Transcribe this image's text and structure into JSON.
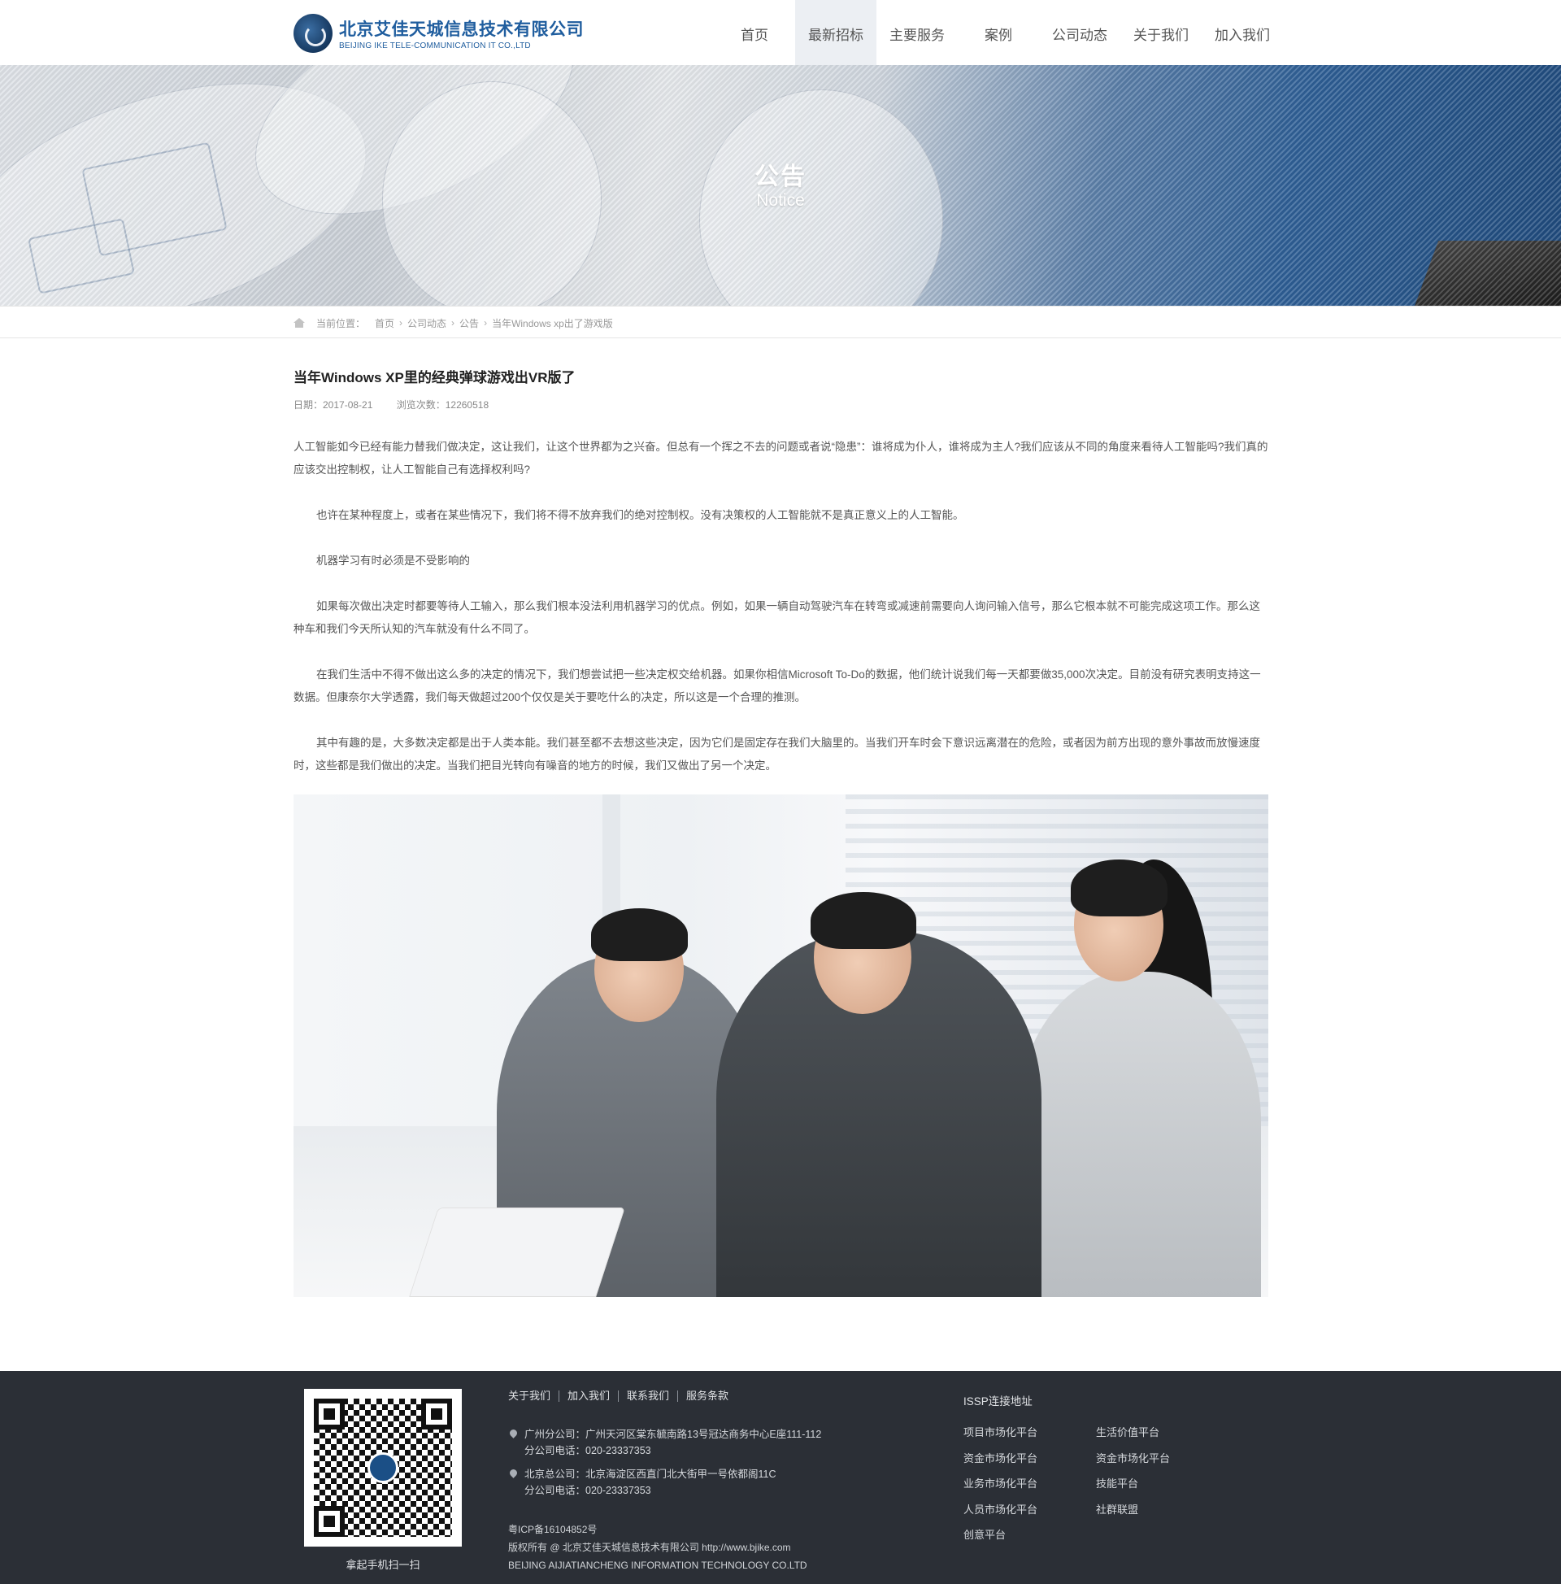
{
  "header": {
    "logo_cn": "北京艾佳天城信息技术有限公司",
    "logo_en": "BEIJING IKE TELE-COMMUNICATION IT CO.,LTD",
    "nav": [
      "首页",
      "最新招标",
      "主要服务",
      "案例",
      "公司动态",
      "关于我们",
      "加入我们"
    ],
    "active_nav": "最新招标"
  },
  "banner": {
    "title": "公告",
    "subtitle": "Notice"
  },
  "breadcrumb": {
    "label": "当前位置：",
    "items": [
      "首页",
      "公司动态",
      "公告",
      "当年Windows xp出了游戏版"
    ]
  },
  "article": {
    "title": "当年Windows XP里的经典弹球游戏出VR版了",
    "date": "日期：2017-08-21",
    "views": "浏览次数：12260518",
    "paragraphs": [
      "人工智能如今已经有能力替我们做决定，这让我们，让这个世界都为之兴奋。但总有一个挥之不去的问题或者说“隐患”：谁将成为仆人，谁将成为主人?我们应该从不同的角度来看待人工智能吗?我们真的应该交出控制权，让人工智能自己有选择权利吗?",
      "也许在某种程度上，或者在某些情况下，我们将不得不放弃我们的绝对控制权。没有决策权的人工智能就不是真正意义上的人工智能。",
      "机器学习有时必须是不受影响的",
      "如果每次做出决定时都要等待人工输入，那么我们根本没法利用机器学习的优点。例如，如果一辆自动驾驶汽车在转弯或减速前需要向人询问输入信号，那么它根本就不可能完成这项工作。那么这种车和我们今天所认知的汽车就没有什么不同了。",
      "在我们生活中不得不做出这么多的决定的情况下，我们想尝试把一些决定权交给机器。如果你相信Microsoft To-Do的数据，他们统计说我们每一天都要做35,000次决定。目前没有研究表明支持这一数据。但康奈尔大学透露，我们每天做超过200个仅仅是关于要吃什么的决定，所以这是一个合理的推测。",
      "其中有趣的是，大多数决定都是出于人类本能。我们甚至都不去想这些决定，因为它们是固定存在我们大脑里的。当我们开车时会下意识远离潜在的危险，或者因为前方出现的意外事故而放慢速度时，这些都是我们做出的决定。当我们把目光转向有噪音的地方的时候，我们又做出了另一个决定。"
    ]
  },
  "footer": {
    "qr_caption": "拿起手机扫一扫",
    "links": [
      "关于我们",
      "加入我们",
      "联系我们",
      "服务条款"
    ],
    "addresses": [
      {
        "line1": "广州分公司：广州天河区棠东毓南路13号冠达商务中心E座111-112",
        "line2": "分公司电话：020-23337353"
      },
      {
        "line1": "北京总公司：北京海淀区西直门北大街甲一号依都阁11C",
        "line2": "分公司电话：020-23337353"
      }
    ],
    "icp": "粤ICP备16104852号",
    "copyright": "版权所有 @ 北京艾佳天城信息技术有限公司 http://www.bjike.com",
    "company_en": "BEIJING AIJIATIANCHENG INFORMATION TECHNOLOGY CO.LTD",
    "issp_title": "ISSP连接地址",
    "issp_col1": [
      "项目市场化平台",
      "资金市场化平台",
      "业务市场化平台",
      "人员市场化平台",
      "创意平台"
    ],
    "issp_col2": [
      "生活价值平台",
      "资金市场化平台",
      "技能平台",
      "社群联盟"
    ]
  },
  "icons": {
    "home": "home-icon",
    "location": "location-pin-icon",
    "qr": "qr-code-icon"
  },
  "colors": {
    "brand_blue": "#1f5d9e",
    "footer_bg": "#2b2f36",
    "nav_active_bg": "#eceff3"
  }
}
